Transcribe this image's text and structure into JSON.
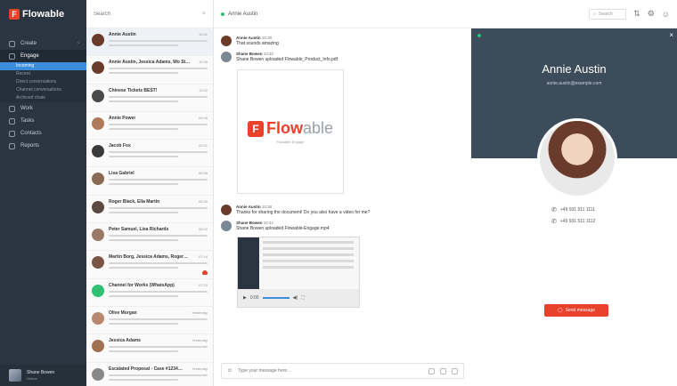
{
  "brand": {
    "name": "Flowable"
  },
  "sidebar": {
    "items": [
      {
        "label": "Create"
      },
      {
        "label": "Engage"
      },
      {
        "label": "Work"
      },
      {
        "label": "Tasks"
      },
      {
        "label": "Contacts"
      },
      {
        "label": "Reports"
      }
    ],
    "subitems": [
      {
        "label": "Incoming"
      },
      {
        "label": "Recent"
      },
      {
        "label": "Direct conversations"
      },
      {
        "label": "Channel conversations"
      },
      {
        "label": "Archived chats"
      }
    ],
    "profile": {
      "name": "Shane Bowen",
      "status": "Online"
    }
  },
  "list": {
    "search_placeholder": "Search",
    "conversations": [
      {
        "name": "Annie Austin",
        "time": "10:41"
      },
      {
        "name": "Annie Austin, Jessica Adams, Wo St…",
        "time": "10:35"
      },
      {
        "name": "Chinese Tickets BEST!",
        "time": "10:02"
      },
      {
        "name": "Annie Power",
        "time": "09:48"
      },
      {
        "name": "Jacob Fox",
        "time": "09:21"
      },
      {
        "name": "Lisa Gabriel",
        "time": "08:55"
      },
      {
        "name": "Roger Black, Ella Martin",
        "time": "08:30"
      },
      {
        "name": "Peter Samuel, Lisa Richards",
        "time": "08:02"
      },
      {
        "name": "Martin Borg, Jessica Adams, Roger…",
        "time": "07:44"
      },
      {
        "name": "Channel for Works (WhatsApp)",
        "time": "07:20"
      },
      {
        "name": "Olive Morgan",
        "time": "Yesterday"
      },
      {
        "name": "Jessica Adams",
        "time": "Yesterday"
      },
      {
        "name": "Escalated Proposal - Case #1234…",
        "time": "Yesterday"
      }
    ]
  },
  "chat": {
    "title": "Annie Austin",
    "messages": [
      {
        "author": "Annie Austin",
        "time": "10:30",
        "text": "That sounds amazing"
      },
      {
        "author": "Shane Bowen",
        "time": "10:32",
        "text": "Shane Bowen uploaded Flowable_Product_Info.pdf"
      },
      {
        "author": "Annie Austin",
        "time": "10:38",
        "text": "Thanks for sharing the document! Do you also have a video for me?"
      },
      {
        "author": "Shane Bowen",
        "time": "10:41",
        "text": "Shane Bowen uploaded Flowable-Engage.mp4"
      }
    ],
    "doc_logo": {
      "main": "Flow",
      "light": "able",
      "tag": "Flowable Engage"
    },
    "video_time": "0:00",
    "composer_placeholder": "Type your message here…"
  },
  "topbar": {
    "search_label": "Search"
  },
  "contact": {
    "name": "Annie Austin",
    "email": "annie.austin@example.com",
    "phones": [
      "+49 931 511 1111",
      "+49 931 511 1112"
    ],
    "send_label": "Send message"
  },
  "colors": {
    "accent": "#e8412c",
    "sidebar": "#2b3541",
    "panel": "#3d4c5b",
    "selected": "#3a8edc"
  }
}
